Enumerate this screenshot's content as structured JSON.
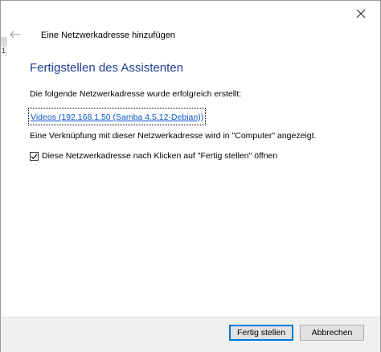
{
  "background": {
    "glyph": "1"
  },
  "titlebar": {
    "close_icon": "close-icon"
  },
  "header": {
    "back_icon": "back-arrow-icon",
    "title": "Eine Netzwerkadresse hinzufügen"
  },
  "content": {
    "heading": "Fertigstellen des Assistenten",
    "success_text": "Die folgende Netzwerkadresse wurde erfolgreich erstellt:",
    "location_link": "Videos (192.168.1.50 (Samba 4.5.12-Debian))",
    "shortcut_text": "Eine Verknüpfung mit dieser Netzwerkadresse wird in \"Computer\" angezeigt.",
    "open_checkbox": {
      "label": "Diese Netzwerkadresse nach Klicken auf \"Fertig stellen\" öffnen",
      "checked": true
    }
  },
  "footer": {
    "finish_label": "Fertig stellen",
    "cancel_label": "Abbrechen"
  },
  "colors": {
    "heading": "#1e3f91",
    "link": "#0a56c9",
    "primary_border": "#0078d7",
    "footer_bg": "#f0f0f0"
  }
}
